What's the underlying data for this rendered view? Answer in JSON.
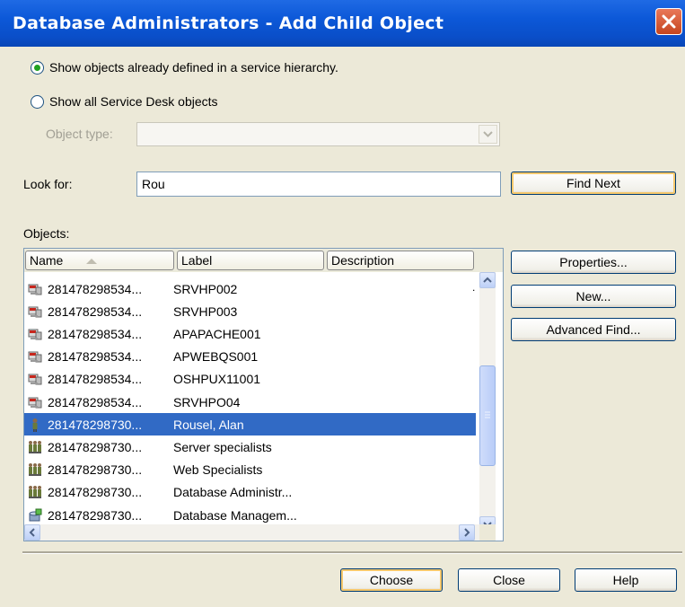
{
  "window": {
    "title": "Database Administrators - Add Child Object"
  },
  "options": {
    "radio_hierarchy": "Show objects already defined in a service hierarchy.",
    "radio_all": "Show all Service Desk objects",
    "object_type_label": "Object type:",
    "object_type_value": "",
    "hierarchy_selected": true
  },
  "search": {
    "label": "Look for:",
    "value": "Rou",
    "find_next": "Find Next"
  },
  "objects": {
    "label": "Objects:",
    "columns": [
      "Name",
      "Label",
      "Description"
    ],
    "sort_column": "Name",
    "rows": [
      {
        "name": "281478298534...",
        "label": "SRVHP002",
        "icon": "server-icon",
        "selected": false
      },
      {
        "name": "281478298534...",
        "label": "SRVHP003",
        "icon": "server-icon",
        "selected": false
      },
      {
        "name": "281478298534...",
        "label": "APAPACHE001",
        "icon": "server-icon",
        "selected": false
      },
      {
        "name": "281478298534...",
        "label": "APWEBQS001",
        "icon": "server-icon",
        "selected": false
      },
      {
        "name": "281478298534...",
        "label": "OSHPUX11001",
        "icon": "server-icon",
        "selected": false
      },
      {
        "name": "281478298534...",
        "label": "SRVHPO04",
        "icon": "server-icon",
        "selected": false
      },
      {
        "name": "281478298730...",
        "label": "Rousel, Alan",
        "icon": "person-icon",
        "selected": true
      },
      {
        "name": "281478298730...",
        "label": "Server specialists",
        "icon": "group-icon",
        "selected": false
      },
      {
        "name": "281478298730...",
        "label": "Web Specialists",
        "icon": "group-icon",
        "selected": false
      },
      {
        "name": "281478298730...",
        "label": "Database Administr...",
        "icon": "group-icon",
        "selected": false
      },
      {
        "name": "281478298730...",
        "label": "Database Managem...",
        "icon": "database-icon",
        "selected": false
      }
    ],
    "stray_text": "."
  },
  "side_buttons": {
    "properties": "Properties...",
    "new": "New...",
    "advanced_find": "Advanced Find..."
  },
  "footer": {
    "choose": "Choose",
    "close": "Close",
    "help": "Help"
  },
  "colors": {
    "titlebar": "#0a4ec8",
    "selection": "#316ac5",
    "dialog_bg": "#ece9d8"
  }
}
